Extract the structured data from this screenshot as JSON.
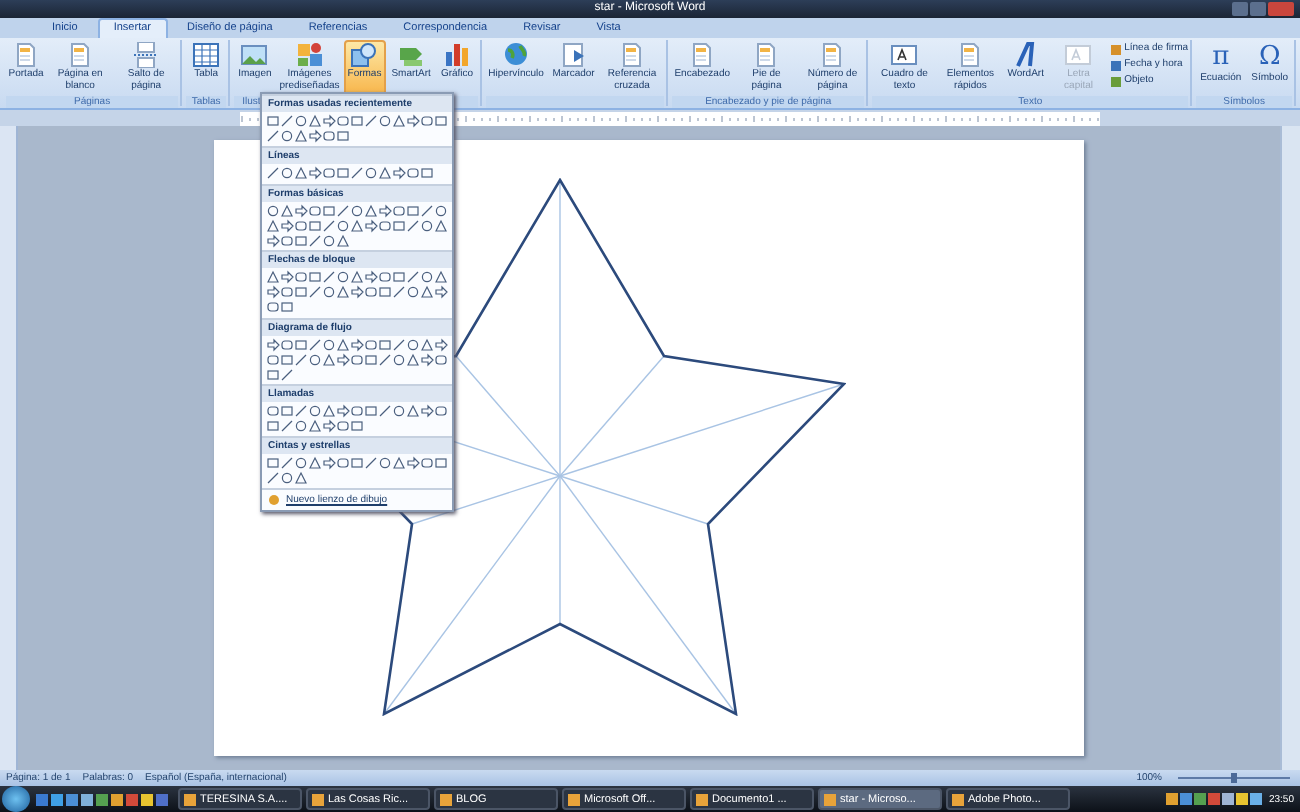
{
  "window": {
    "title": "star - Microsoft Word"
  },
  "tabs": [
    {
      "label": "Inicio",
      "selected": false
    },
    {
      "label": "Insertar",
      "selected": true
    },
    {
      "label": "Diseño de página",
      "selected": false
    },
    {
      "label": "Referencias",
      "selected": false
    },
    {
      "label": "Correspondencia",
      "selected": false
    },
    {
      "label": "Revisar",
      "selected": false
    },
    {
      "label": "Vista",
      "selected": false
    }
  ],
  "ribbon": [
    {
      "label": "Páginas",
      "buttons": [
        {
          "label": "Portada",
          "kind": "page",
          "selected": false,
          "disabled": false
        },
        {
          "label": "Página en blanco",
          "kind": "page",
          "selected": false,
          "disabled": false
        },
        {
          "label": "Salto de página",
          "kind": "break",
          "selected": false,
          "disabled": false
        }
      ]
    },
    {
      "label": "Tablas",
      "buttons": [
        {
          "label": "Tabla",
          "kind": "table",
          "selected": false,
          "disabled": false
        }
      ]
    },
    {
      "label": "Ilust",
      "buttons": [
        {
          "label": "Imagen",
          "kind": "image",
          "selected": false,
          "disabled": false
        },
        {
          "label": "Imágenes prediseñadas",
          "kind": "clipart",
          "selected": false,
          "disabled": false
        },
        {
          "label": "Formas",
          "kind": "shapes",
          "selected": true,
          "disabled": false
        },
        {
          "label": "SmartArt",
          "kind": "smartart",
          "selected": false,
          "disabled": false
        },
        {
          "label": "Gráfico",
          "kind": "chart",
          "selected": false,
          "disabled": false
        }
      ]
    },
    {
      "buttons": [
        {
          "label": "Hipervínculo",
          "kind": "globe",
          "selected": false,
          "disabled": false
        },
        {
          "label": "Marcador",
          "kind": "bookmark",
          "selected": false,
          "disabled": false
        },
        {
          "label": "Referencia cruzada",
          "kind": "page",
          "selected": false,
          "disabled": false
        }
      ]
    },
    {
      "label": "Encabezado y pie de página",
      "buttons": [
        {
          "label": "Encabezado",
          "kind": "page",
          "selected": false,
          "disabled": false
        },
        {
          "label": "Pie de página",
          "kind": "page",
          "selected": false,
          "disabled": false
        },
        {
          "label": "Número de página",
          "kind": "page",
          "selected": false,
          "disabled": false
        }
      ]
    },
    {
      "label": "Texto",
      "buttons": [
        {
          "label": "Cuadro de texto",
          "kind": "textbox",
          "selected": false,
          "disabled": false
        },
        {
          "label": "Elementos rápidos",
          "kind": "page",
          "selected": false,
          "disabled": false
        },
        {
          "label": "WordArt",
          "kind": "wordart",
          "selected": false,
          "disabled": false
        },
        {
          "label": "Letra capital",
          "kind": "textbox",
          "selected": false,
          "disabled": true
        }
      ],
      "small": [
        "Línea de firma",
        "Fecha y hora",
        "Objeto"
      ]
    },
    {
      "label": "Símbolos",
      "buttons": [
        {
          "label": "Ecuación",
          "kind": "glyph",
          "glyph": "π",
          "selected": false,
          "disabled": false
        },
        {
          "label": "Símbolo",
          "kind": "glyph",
          "glyph": "Ω",
          "selected": false,
          "disabled": false
        }
      ]
    }
  ],
  "shapes_menu": {
    "sections": [
      {
        "title": "Formas usadas recientemente"
      },
      {
        "title": "Líneas"
      },
      {
        "title": "Formas básicas"
      },
      {
        "title": "Flechas de bloque"
      },
      {
        "title": "Diagrama de flujo"
      },
      {
        "title": "Llamadas"
      },
      {
        "title": "Cintas y estrellas"
      }
    ],
    "footer": "Nuevo lienzo de dibujo"
  },
  "status_bar": {
    "page": "Página: 1 de 1",
    "words": "Palabras: 0",
    "language": "Español (España, internacional)",
    "zoom": "100%",
    "zoom_slider": {
      "level": 0.5
    }
  },
  "taskbar": {
    "items": [
      {
        "label": "TERESINA S.A....",
        "selected": false
      },
      {
        "label": "Las Cosas Ric...",
        "selected": false
      },
      {
        "label": "BLOG",
        "selected": false
      },
      {
        "label": "Microsoft Off...",
        "selected": false
      },
      {
        "label": "Documento1 ...",
        "selected": false
      },
      {
        "label": "star - Microso...",
        "selected": true
      },
      {
        "label": "Adobe Photo...",
        "selected": false
      }
    ],
    "clock": "23:50"
  }
}
